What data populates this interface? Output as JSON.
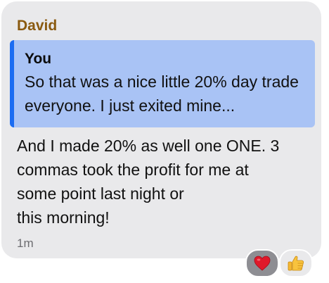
{
  "message": {
    "sender_name": "David",
    "quote": {
      "author": "You",
      "text": "So that was a nice little 20% day trade everyone. I just exited mine..."
    },
    "body_lines": [
      "And I made 20% as well one ONE. 3",
      "commas took the profit for me at",
      "some point last night or",
      "this morning!"
    ],
    "timestamp": "1m",
    "reactions": [
      {
        "icon": "heart-icon",
        "color": "#e0192a"
      },
      {
        "icon": "thumbs-up-icon",
        "color": "#f5b731"
      }
    ]
  },
  "colors": {
    "bubble": "#e9e9eb",
    "sender": "#8a5a10",
    "quote_background": "#a9c3f5",
    "quote_bar": "#1b6cf2"
  }
}
